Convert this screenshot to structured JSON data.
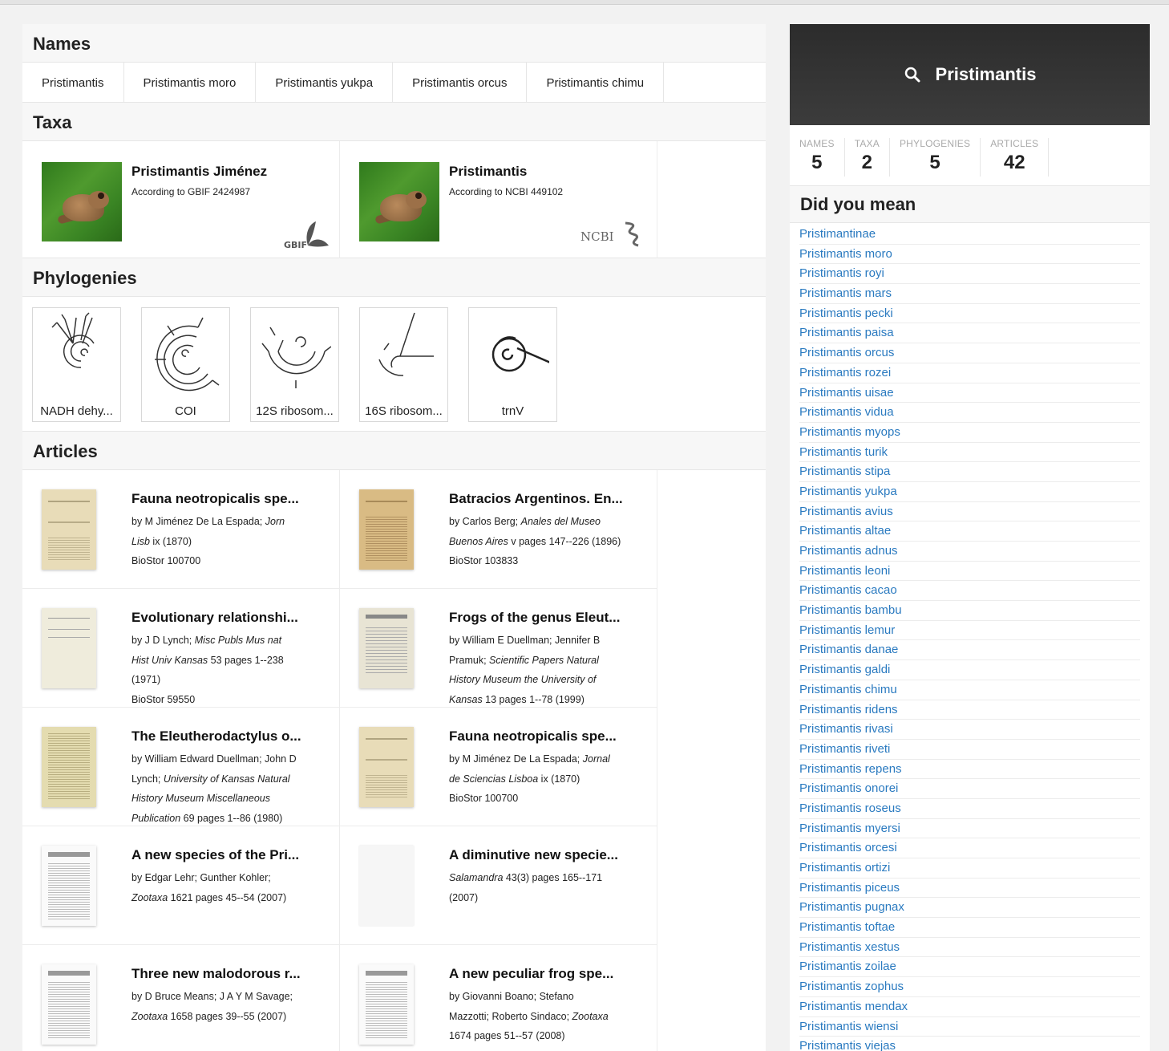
{
  "sections": {
    "names": "Names",
    "taxa": "Taxa",
    "phylogenies": "Phylogenies",
    "articles": "Articles"
  },
  "names": [
    "Pristimantis",
    "Pristimantis moro",
    "Pristimantis yukpa",
    "Pristimantis orcus",
    "Pristimantis chimu"
  ],
  "taxa": [
    {
      "title": "Pristimantis Jiménez",
      "subtitle": "According to GBIF 2424987",
      "logo": "GBIF"
    },
    {
      "title": "Pristimantis",
      "subtitle": "According to NCBI 449102",
      "logo": "NCBI"
    }
  ],
  "phylogenies": [
    {
      "label": "NADH dehy..."
    },
    {
      "label": "COI"
    },
    {
      "label": "12S ribosom..."
    },
    {
      "label": "16S ribosom..."
    },
    {
      "label": "trnV"
    }
  ],
  "articles": [
    {
      "title": "Fauna neotropicalis spe...",
      "l1": "by M Jiménez De La Espada; ",
      "l1i": "Jorn",
      "l2i": "Lisb",
      "l2": " ix (1870)",
      "l3": "BioStor 100700",
      "l3i": "",
      "l4": "",
      "l4i": "",
      "l5": ""
    },
    {
      "title": "Batracios Argentinos. En...",
      "l1": "by Carlos Berg; ",
      "l1i": "Anales del Museo",
      "l2i": "Buenos Aires",
      "l2": " v pages 147--226 (1896)",
      "l3": "BioStor 103833",
      "l3i": "",
      "l4": "",
      "l4i": "",
      "l5": ""
    },
    {
      "title": "Evolutionary relationshi...",
      "l1": "by J D Lynch; ",
      "l1i": "Misc Publs Mus nat",
      "l2i": "Hist Univ Kansas",
      "l2": " 53 pages 1--238",
      "l3": "(1971)",
      "l3i": "",
      "l4": "BioStor 59550",
      "l4i": "",
      "l5": ""
    },
    {
      "title": "Frogs of the genus Eleut...",
      "l1": "by William E Duellman; Jennifer B",
      "l1i": "",
      "l2i": "",
      "l2": "Pramuk; ",
      "l3": "",
      "l3i": "Scientific Papers Natural",
      "l4": "",
      "l4i": "History Museum the University of",
      "l5i": "Kansas",
      "l5": " 13 pages 1--78 (1999)"
    },
    {
      "title": "The Eleutherodactylus o...",
      "l1": "by William Edward Duellman; John D",
      "l1i": "",
      "l2i": "",
      "l2": "Lynch; ",
      "l3": "",
      "l3i": "University of Kansas Natural",
      "l4": "",
      "l4i": "History Museum Miscellaneous",
      "l5i": "Publication",
      "l5": " 69 pages 1--86 (1980)"
    },
    {
      "title": "Fauna neotropicalis spe...",
      "l1": "by M Jiménez De La Espada; ",
      "l1i": "Jornal",
      "l2i": "de Sciencias Lisboa",
      "l2": " ix (1870)",
      "l3": "BioStor 100700",
      "l3i": "",
      "l4": "",
      "l4i": "",
      "l5": ""
    },
    {
      "title": "A new species of the Pri...",
      "l1": "by Edgar Lehr; Gunther Kohler;",
      "l1i": "",
      "l2i": "Zootaxa",
      "l2": " 1621 pages 45--54 (2007)",
      "l3": "",
      "l3i": "",
      "l4": "",
      "l4i": "",
      "l5": ""
    },
    {
      "title": "A diminutive new specie...",
      "l1": "",
      "l1i": "",
      "l2i": "Salamandra",
      "l2": " 43(3) pages 165--171",
      "l3": "(2007)",
      "l3i": "",
      "l4": "",
      "l4i": "",
      "l5": ""
    },
    {
      "title": "Three new malodorous r...",
      "l1": "by D Bruce Means; J A Y M Savage;",
      "l1i": "",
      "l2i": "Zootaxa",
      "l2": " 1658 pages 39--55 (2007)",
      "l3": "",
      "l3i": "",
      "l4": "",
      "l4i": "",
      "l5": ""
    },
    {
      "title": "A new peculiar frog spe...",
      "l1": "by Giovanni Boano; Stefano",
      "l1i": "",
      "l2i": "",
      "l2": "Mazzotti; Roberto Sindaco; ",
      "l3": "1674 pages 51--57 (2008)",
      "l3i": "",
      "l4": "",
      "l4i": "",
      "l5": ""
    }
  ],
  "article_extra_italic": "Zootaxa",
  "search": {
    "query": "Pristimantis"
  },
  "stats": [
    {
      "label": "NAMES",
      "value": "5"
    },
    {
      "label": "TAXA",
      "value": "2"
    },
    {
      "label": "PHYLOGENIES",
      "value": "5"
    },
    {
      "label": "ARTICLES",
      "value": "42"
    }
  ],
  "did_you_mean": {
    "title": "Did you mean",
    "items": [
      "Pristimantinae",
      "Pristimantis moro",
      "Pristimantis royi",
      "Pristimantis mars",
      "Pristimantis pecki",
      "Pristimantis paisa",
      "Pristimantis orcus",
      "Pristimantis rozei",
      "Pristimantis uisae",
      "Pristimantis vidua",
      "Pristimantis myops",
      "Pristimantis turik",
      "Pristimantis stipa",
      "Pristimantis yukpa",
      "Pristimantis avius",
      "Pristimantis altae",
      "Pristimantis adnus",
      "Pristimantis leoni",
      "Pristimantis cacao",
      "Pristimantis bambu",
      "Pristimantis lemur",
      "Pristimantis danae",
      "Pristimantis galdi",
      "Pristimantis chimu",
      "Pristimantis ridens",
      "Pristimantis rivasi",
      "Pristimantis riveti",
      "Pristimantis repens",
      "Pristimantis onorei",
      "Pristimantis roseus",
      "Pristimantis myersi",
      "Pristimantis orcesi",
      "Pristimantis ortizi",
      "Pristimantis piceus",
      "Pristimantis pugnax",
      "Pristimantis toftae",
      "Pristimantis xestus",
      "Pristimantis zoilae",
      "Pristimantis zophus",
      "Pristimantis mendax",
      "Pristimantis wiensi",
      "Pristimantis viejas"
    ]
  },
  "colors": {
    "link": "#2a7ac0",
    "search_bg": "#333333"
  }
}
